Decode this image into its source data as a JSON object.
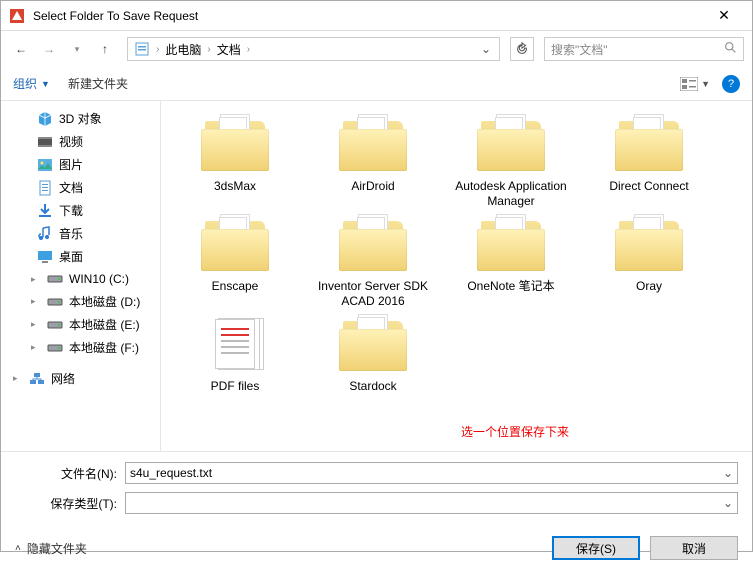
{
  "window": {
    "title": "Select Folder To Save Request"
  },
  "breadcrumb": {
    "root": "此电脑",
    "segment": "文档"
  },
  "search": {
    "placeholder": "搜索\"文档\""
  },
  "toolbar": {
    "organize": "组织",
    "new_folder": "新建文件夹"
  },
  "sidebar": {
    "items": [
      {
        "label": "3D 对象",
        "icon": "3d"
      },
      {
        "label": "视频",
        "icon": "video"
      },
      {
        "label": "图片",
        "icon": "pictures"
      },
      {
        "label": "文档",
        "icon": "documents"
      },
      {
        "label": "下载",
        "icon": "downloads"
      },
      {
        "label": "音乐",
        "icon": "music"
      },
      {
        "label": "桌面",
        "icon": "desktop"
      },
      {
        "label": "WIN10 (C:)",
        "icon": "drive"
      },
      {
        "label": "本地磁盘 (D:)",
        "icon": "drive"
      },
      {
        "label": "本地磁盘 (E:)",
        "icon": "drive"
      },
      {
        "label": "本地磁盘 (F:)",
        "icon": "drive"
      }
    ],
    "network": "网络"
  },
  "folders": [
    {
      "label": "3dsMax",
      "type": "folder"
    },
    {
      "label": "AirDroid",
      "type": "folder"
    },
    {
      "label": "Autodesk Application Manager",
      "type": "folder"
    },
    {
      "label": "Direct Connect",
      "type": "folder"
    },
    {
      "label": "Enscape",
      "type": "folder"
    },
    {
      "label": "Inventor Server SDK ACAD 2016",
      "type": "folder"
    },
    {
      "label": "OneNote 笔记本",
      "type": "folder"
    },
    {
      "label": "Oray",
      "type": "folder"
    },
    {
      "label": "PDF files",
      "type": "pdf"
    },
    {
      "label": "Stardock",
      "type": "folder"
    }
  ],
  "annotation": "选一个位置保存下来",
  "form": {
    "filename_label": "文件名(N):",
    "filename_value": "s4u_request.txt",
    "filetype_label": "保存类型(T):",
    "filetype_value": ""
  },
  "footer": {
    "hide_folders": "隐藏文件夹",
    "save": "保存(S)",
    "cancel": "取消"
  }
}
